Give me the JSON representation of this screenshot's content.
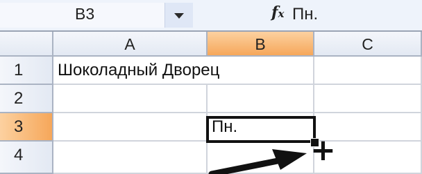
{
  "formula_bar": {
    "name_box": "B3",
    "fx_icon": "fx",
    "formula_value": "Пн."
  },
  "columns": [
    {
      "label": "A",
      "active": false
    },
    {
      "label": "B",
      "active": true
    },
    {
      "label": "C",
      "active": false
    }
  ],
  "rows": [
    {
      "label": "1",
      "active": false
    },
    {
      "label": "2",
      "active": false
    },
    {
      "label": "3",
      "active": true
    },
    {
      "label": "4",
      "active": false
    }
  ],
  "cells": {
    "A1": "Шоколадный Дворец",
    "B3": "Пн."
  },
  "selected_cell": "B3",
  "colors": {
    "active_header": "#f6a75a",
    "header": "#e3e9f3",
    "grid_line": "#d0d4dc",
    "selection_border": "#111111"
  },
  "icons": {
    "dropdown": "chevron-down-icon",
    "formula": "fx-icon",
    "fill_cursor": "plus-cursor-icon",
    "pointer_arrow": "arrow-icon"
  }
}
